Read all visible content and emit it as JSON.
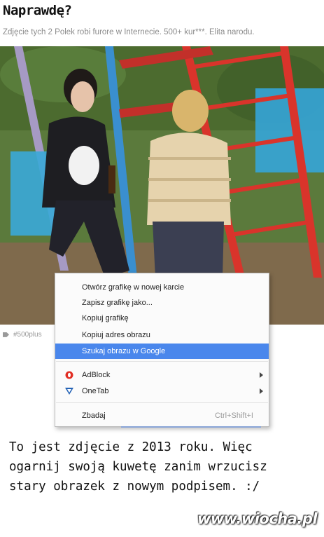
{
  "header": {
    "title": "Naprawdę?",
    "subtitle": "Zdjęcie tych 2 Polek robi furore w Internecie. 500+ kur***. Elita narodu."
  },
  "post": {
    "tag": "#500plus"
  },
  "context_menu": {
    "items": [
      {
        "label": "Otwórz grafikę w nowej karcie"
      },
      {
        "label": "Zapisz grafikę jako..."
      },
      {
        "label": "Kopiuj grafikę"
      },
      {
        "label": "Kopiuj adres obrazu"
      },
      {
        "label": "Szukaj obrazu w Google",
        "highlighted": true
      }
    ],
    "extensions": [
      {
        "label": "AdBlock",
        "icon": "adblock-icon",
        "has_submenu": true
      },
      {
        "label": "OneTab",
        "icon": "onetab-icon",
        "has_submenu": true
      }
    ],
    "inspect": {
      "label": "Zbadaj",
      "shortcut": "Ctrl+Shift+I"
    },
    "highlight_color": "#4a87ec"
  },
  "caption": {
    "lines": [
      "To jest zdjęcie z 2013 roku. Więc",
      "ogarnij swoją kuwetę zanim wrzucisz",
      "stary obrazek z nowym podpisem. :/"
    ]
  },
  "watermark": "www.wiocha.pl"
}
